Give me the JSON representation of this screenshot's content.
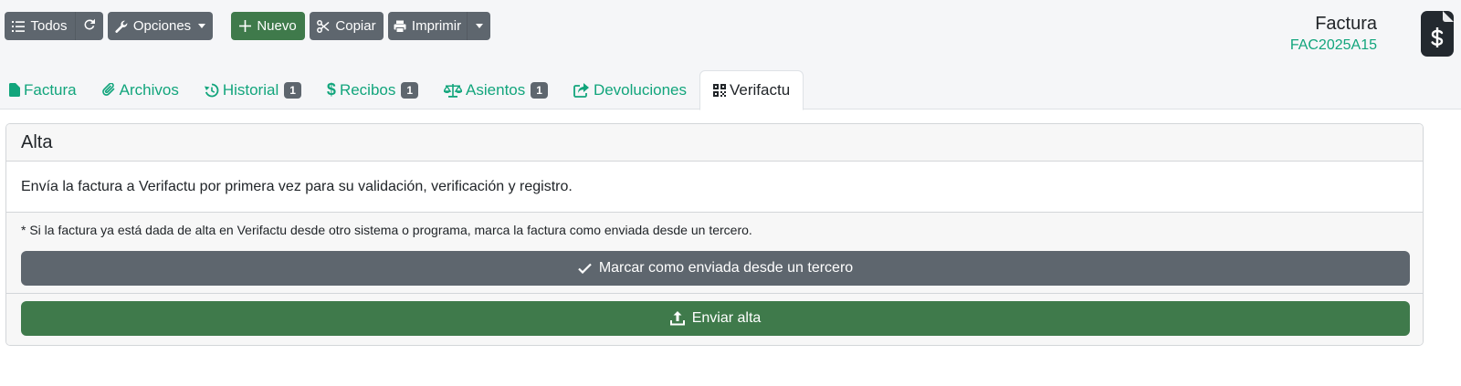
{
  "toolbar": {
    "all_label": "Todos",
    "options_label": "Opciones",
    "new_label": "Nuevo",
    "copy_label": "Copiar",
    "print_label": "Imprimir"
  },
  "header": {
    "title": "Factura",
    "code": "FAC2025A15"
  },
  "tabs": [
    {
      "label": "Factura"
    },
    {
      "label": "Archivos"
    },
    {
      "label": "Historial",
      "badge": "1"
    },
    {
      "label": "Recibos",
      "badge": "1"
    },
    {
      "label": "Asientos",
      "badge": "1"
    },
    {
      "label": "Devoluciones"
    },
    {
      "label": "Verifactu",
      "active": true
    }
  ],
  "card": {
    "title": "Alta",
    "description": "Envía la factura a Verifactu por primera vez para su validación, verificación y registro.",
    "note": "* Si la factura ya está dada de alta en Verifactu desde otro sistema o programa, marca la factura como enviada desde un tercero.",
    "mark_button": "Marcar como enviada desde un tercero",
    "send_button": "Enviar alta"
  },
  "colors": {
    "accent_green": "#12a57c",
    "button_grey": "#5e666e",
    "button_green": "#3f7a4b"
  }
}
